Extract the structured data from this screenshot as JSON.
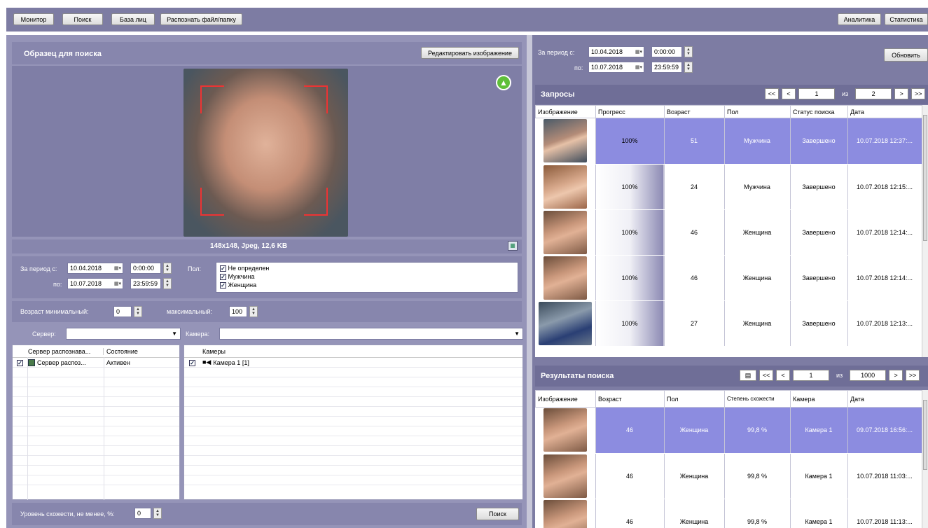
{
  "toolbar": {
    "monitor": "Монитор",
    "search": "Поиск",
    "facebase": "База лиц",
    "recognize": "Распознать файл/папку",
    "analytics": "Аналитика",
    "statistics": "Статистика"
  },
  "sample": {
    "title": "Образец для поиска",
    "edit_button": "Редактировать изображение",
    "image_info": "148x148, Jpeg, 12,6 KB"
  },
  "filters": {
    "period_from_label": "За период с:",
    "period_to_label": "по:",
    "from_date": "10.04.2018",
    "from_time": "0:00:00",
    "to_date": "10.07.2018",
    "to_time": "23:59:59",
    "gender_label": "Пол:",
    "gender_options": [
      "Не определен",
      "Мужчина",
      "Женщина"
    ],
    "age_min_label": "Возраст минимальный:",
    "age_min": "0",
    "age_max_label": "максимальный:",
    "age_max": "100",
    "server_label": "Сервер:",
    "camera_label": "Камера:"
  },
  "servers": {
    "col1": "Сервер распознава...",
    "col2": "Состояние",
    "rows": [
      {
        "name": "Сервер распоз...",
        "state": "Активен"
      }
    ]
  },
  "cameras": {
    "col1": "Камеры",
    "rows": [
      {
        "name": "Камера 1 [1]"
      }
    ]
  },
  "similarity": {
    "label": "Уровень схожести, не менее, %:",
    "value": "0",
    "search_button": "Поиск"
  },
  "right_filter": {
    "period_from_label": "За период с:",
    "period_to_label": "по:",
    "from_date": "10.04.2018",
    "from_time": "0:00:00",
    "to_date": "10.07.2018",
    "to_time": "23:59:59",
    "refresh_button": "Обновить"
  },
  "requests": {
    "title": "Запросы",
    "page": "1",
    "of_label": "из",
    "total": "2",
    "headers": [
      "Изображение",
      "Прогресс",
      "Возраст",
      "Пол",
      "Статус поиска",
      "Дата"
    ],
    "rows": [
      {
        "progress": "100%",
        "age": "51",
        "gender": "Мужчина",
        "status": "Завершено",
        "date": "10.07.2018 12:37:..."
      },
      {
        "progress": "100%",
        "age": "24",
        "gender": "Мужчина",
        "status": "Завершено",
        "date": "10.07.2018 12:15:..."
      },
      {
        "progress": "100%",
        "age": "46",
        "gender": "Женщина",
        "status": "Завершено",
        "date": "10.07.2018 12:14:..."
      },
      {
        "progress": "100%",
        "age": "46",
        "gender": "Женщина",
        "status": "Завершено",
        "date": "10.07.2018 12:14:..."
      },
      {
        "progress": "100%",
        "age": "27",
        "gender": "Женщина",
        "status": "Завершено",
        "date": "10.07.2018 12:13:..."
      }
    ]
  },
  "results": {
    "title": "Результаты поиска",
    "page": "1",
    "of_label": "из",
    "total": "1000",
    "headers": [
      "Изображение",
      "Возраст",
      "Пол",
      "Степень схожести",
      "Камера",
      "Дата"
    ],
    "rows": [
      {
        "age": "46",
        "gender": "Женщина",
        "similarity": "99,8 %",
        "camera": "Камера 1",
        "date": "09.07.2018 16:56:..."
      },
      {
        "age": "46",
        "gender": "Женщина",
        "similarity": "99,8 %",
        "camera": "Камера 1",
        "date": "10.07.2018 11:03:..."
      },
      {
        "age": "46",
        "gender": "Женщина",
        "similarity": "99,8 %",
        "camera": "Камера 1",
        "date": "10.07.2018 11:13:..."
      }
    ]
  },
  "pager_icons": {
    "first": "<<",
    "prev": "<",
    "next": ">",
    "last": ">>"
  }
}
